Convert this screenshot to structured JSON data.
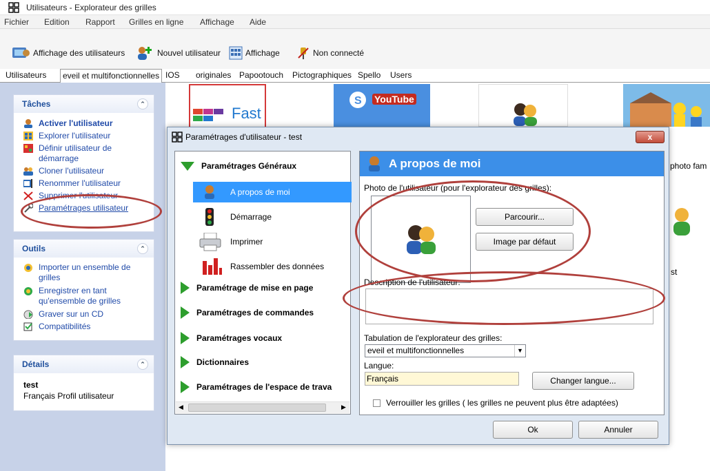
{
  "window": {
    "title": "Utilisateurs - Explorateur des grilles"
  },
  "menu": [
    "Fichier",
    "Edition",
    "Rapport",
    "Grilles en ligne",
    "Affichage",
    "Aide"
  ],
  "toolbar": {
    "users_view": "Affichage des utilisateurs",
    "new_user": "Nouvel utilisateur",
    "view": "Affichage",
    "connection": "Non connecté"
  },
  "tabs": [
    "Utilisateurs",
    "eveil et multifonctionnelles",
    "IOS",
    "originales",
    "Papootouch",
    "Pictographiques",
    "Spello",
    "Users"
  ],
  "tasks": {
    "title": "Tâches",
    "items": [
      "Activer l'utilisateur",
      "Explorer l'utilisateur",
      "Définir utilisateur de démarrage",
      "Cloner l'utilisateur",
      "Renommer l'utilisateur",
      "Supprimer l'utilisateur",
      "Paramétrages utilisateur"
    ]
  },
  "tools": {
    "title": "Outils",
    "items": [
      "Importer un ensemble de grilles",
      "Enregistrer en tant qu'ensemble de grilles",
      "Graver sur un CD",
      "Compatibilités"
    ]
  },
  "details": {
    "title": "Détails",
    "name": "test",
    "info": "Français Profil utilisateur"
  },
  "tiles": {
    "fast": "Fast",
    "youtube": "YouTube",
    "family": "photo fam",
    "st": "st"
  },
  "dialog": {
    "title": "Paramétrages d'utilisateur - test",
    "close": "x",
    "nav": {
      "general": "Paramétrages Généraux",
      "sub": [
        "A propos de moi",
        "Démarrage",
        "Imprimer",
        "Rassembler des données"
      ],
      "sections": [
        "Paramétrage de mise en page",
        "Paramétrages de commandes",
        "Paramétrages vocaux",
        "Dictionnaires",
        "Paramétrages de l'espace de trava"
      ]
    },
    "content": {
      "header": "A propos de moi",
      "photo_label": "Photo de l'utilisateur (pour l'explorateur des grilles):",
      "browse": "Parcourir...",
      "default_image": "Image par défaut",
      "desc_label": "Description de l'utilisateur:",
      "desc_value": "",
      "tab_label": "Tabulation de l'explorateur des grilles:",
      "tab_value": "eveil et multifonctionnelles",
      "lang_label": "Langue:",
      "lang_value": "Français",
      "change_lang": "Changer langue...",
      "lock": "Verrouiller les grilles ( les grilles ne peuvent plus être adaptées)"
    },
    "ok": "Ok",
    "cancel": "Annuler"
  }
}
